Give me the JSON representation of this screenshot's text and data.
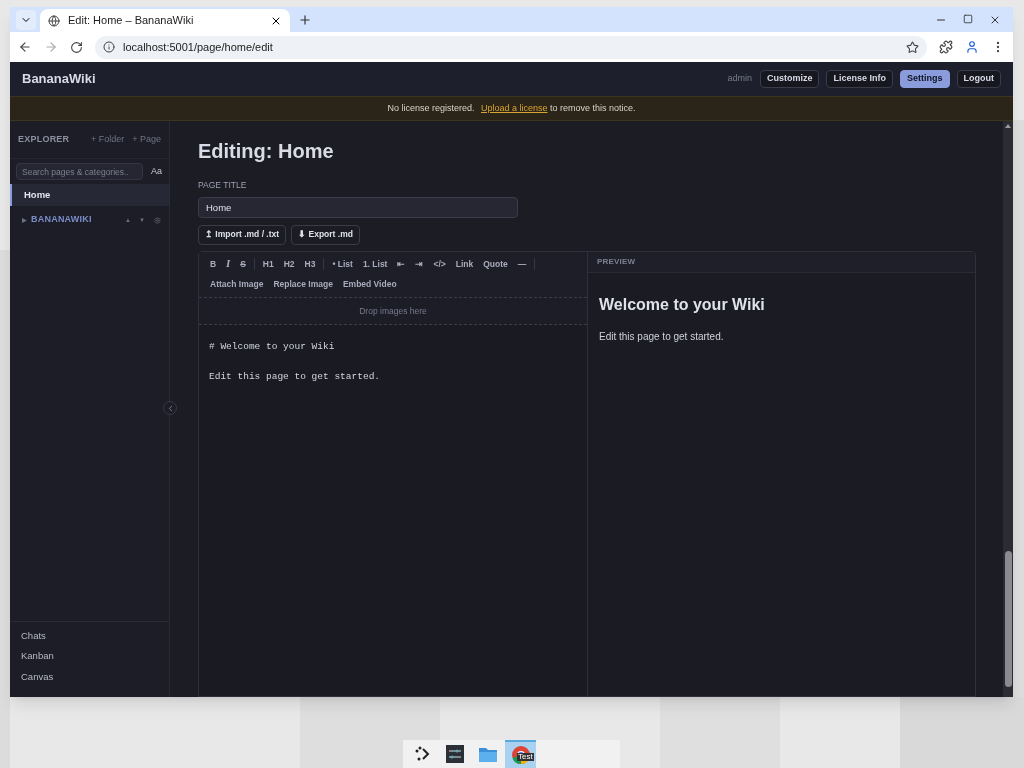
{
  "browser": {
    "tab_title": "Edit: Home – BananaWiki",
    "url": "localhost:5001/page/home/edit"
  },
  "header": {
    "brand": "BananaWiki",
    "user": "admin",
    "buttons": [
      {
        "label": "Customize",
        "selected": false
      },
      {
        "label": "License Info",
        "selected": false
      },
      {
        "label": "Settings",
        "selected": true
      },
      {
        "label": "Logout",
        "selected": false
      }
    ]
  },
  "notice": {
    "before": "No license registered.",
    "link": "Upload a license",
    "after": "to remove this notice."
  },
  "sidebar": {
    "title": "EXPLORER",
    "actions": [
      "+ Folder",
      "+ Page"
    ],
    "search_placeholder": "Search pages & categories..",
    "case_toggle": "Aa",
    "pages": [
      {
        "label": "Home",
        "selected": true
      }
    ],
    "categories": [
      {
        "label": "BANANAWIKI",
        "expanded": false,
        "controls": [
          "▲",
          "▼"
        ]
      }
    ],
    "footer_links": [
      "Chats",
      "Kanban",
      "Canvas"
    ]
  },
  "editor": {
    "heading": "Editing: Home",
    "field_label": "PAGE TITLE",
    "title_value": "Home",
    "file_buttons": [
      "↥ Import .md / .txt",
      "⬇ Export .md"
    ],
    "toolbar_groups": [
      [
        {
          "label": "B",
          "kind": "bold"
        },
        {
          "label": "I",
          "kind": "italic"
        },
        {
          "label": "S",
          "kind": "strike"
        }
      ],
      [
        {
          "label": "H1",
          "kind": "plain"
        },
        {
          "label": "H2",
          "kind": "plain"
        },
        {
          "label": "H3",
          "kind": "plain"
        }
      ],
      [
        {
          "label": "• List",
          "kind": "plain"
        },
        {
          "label": "1. List",
          "kind": "plain"
        },
        {
          "label": "⇤",
          "kind": "plain"
        },
        {
          "label": "⇥",
          "kind": "plain"
        },
        {
          "label": "</>",
          "kind": "plain"
        },
        {
          "label": "Link",
          "kind": "plain"
        },
        {
          "label": "Quote",
          "kind": "plain"
        },
        {
          "label": "—",
          "kind": "plain"
        }
      ]
    ],
    "media_buttons": [
      "Attach Image",
      "Replace Image",
      "Embed Video"
    ],
    "dropzone": "Drop images here",
    "source_lines": [
      "# Welcome to your Wiki",
      "Edit this page to get started."
    ],
    "preview": {
      "label": "PREVIEW",
      "heading": "Welcome to your Wiki",
      "paragraph": "Edit this page to get started."
    }
  },
  "taskbar": [
    {
      "kind": "launcher",
      "selected": false
    },
    {
      "kind": "settings",
      "selected": false
    },
    {
      "kind": "files",
      "selected": false
    },
    {
      "kind": "browser",
      "selected": true,
      "badge": "Test"
    }
  ]
}
